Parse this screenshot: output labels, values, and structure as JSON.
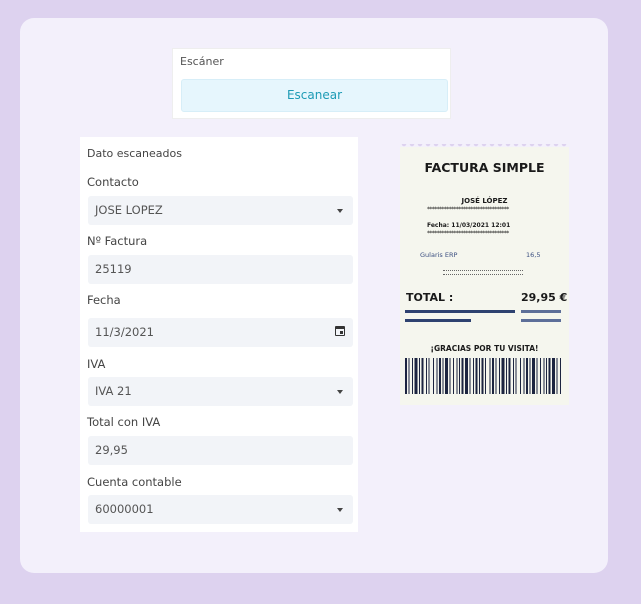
{
  "scanner": {
    "title": "Escáner",
    "button_label": "Escanear"
  },
  "form": {
    "heading": "Dato escaneados",
    "contact": {
      "label": "Contacto",
      "value": "JOSE LOPEZ"
    },
    "invoice_number": {
      "label": "Nº Factura",
      "value": "25119"
    },
    "date": {
      "label": "Fecha",
      "value": "11/3/2021"
    },
    "vat": {
      "label": "IVA",
      "value": "IVA 21"
    },
    "total": {
      "label": "Total con IVA",
      "value": "29,95"
    },
    "account": {
      "label": "Cuenta contable",
      "value": "60000001"
    }
  },
  "receipt": {
    "title": "FACTURA SIMPLE",
    "customer": "JOSÉ LÓPEZ",
    "stars": "**********************************",
    "date_line": "Fecha:   11/03/2021 12:01",
    "item_name": "Gularis ERP",
    "item_price": "16,5",
    "total_label": "TOTAL :",
    "total_value": "29,95 €",
    "thanks": "¡GRACIAS POR TU VISITA!"
  },
  "colors": {
    "background": "#ddd2ef",
    "panel": "#f3f0fb",
    "accent": "#1d9bb5",
    "receipt_bars": "#2e4270"
  }
}
